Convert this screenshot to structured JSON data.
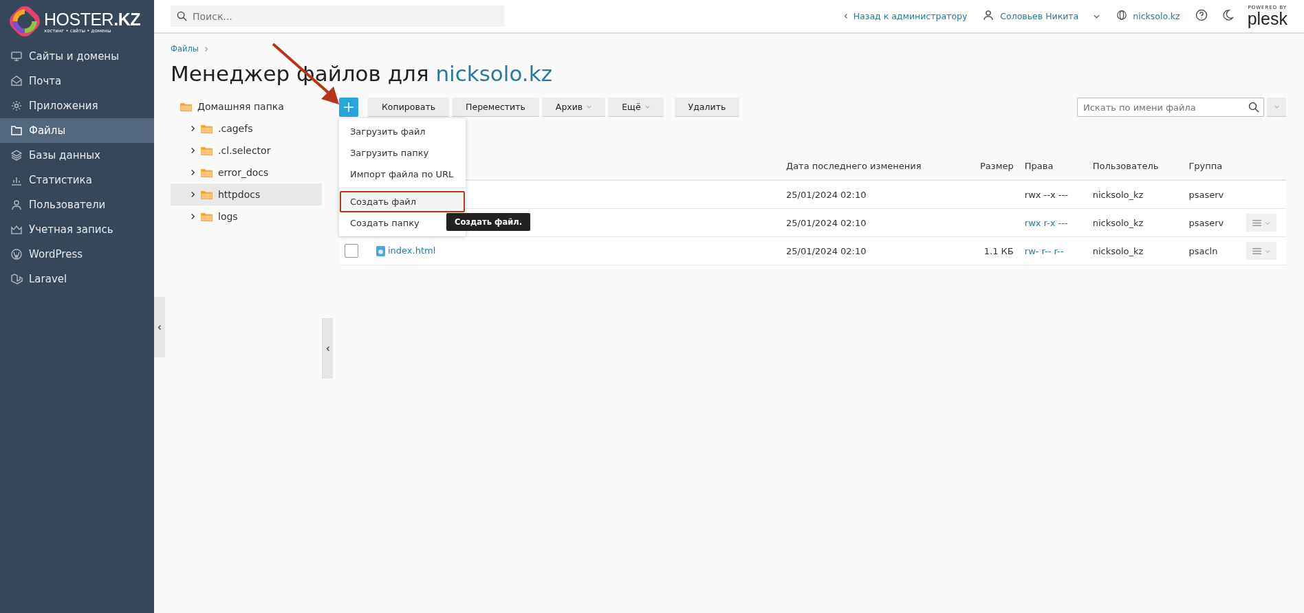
{
  "brand": {
    "name": "HOSTER**.KZ**",
    "tagline": "хостинг • сайты • домены"
  },
  "sidebar": {
    "items": [
      {
        "label": "Сайты и домены",
        "kind": "monitor",
        "selected": false
      },
      {
        "label": "Почта",
        "kind": "mail",
        "selected": false
      },
      {
        "label": "Приложения",
        "kind": "gear",
        "selected": false
      },
      {
        "label": "Файлы",
        "kind": "folder",
        "selected": true
      },
      {
        "label": "Базы данных",
        "kind": "layers",
        "selected": false
      },
      {
        "label": "Статистика",
        "kind": "chart",
        "selected": false
      },
      {
        "label": "Пользователи",
        "kind": "user",
        "selected": false
      },
      {
        "label": "Учетная запись",
        "kind": "crown",
        "selected": false
      },
      {
        "label": "WordPress",
        "kind": "wp",
        "selected": false
      },
      {
        "label": "Laravel",
        "kind": "laravel",
        "selected": false
      }
    ]
  },
  "topbar": {
    "search": {
      "placeholder": "Поиск..."
    },
    "back": "Назад к администратору",
    "user": "Соловьев Никита",
    "domain": "nicksolo.kz",
    "powered_by": "POWERED BY",
    "plesk": "plesk"
  },
  "breadcrumb": [
    "Файлы"
  ],
  "title": {
    "text": "Менеджер файлов для ",
    "domain": "nicksolo.kz"
  },
  "tree": {
    "root": "Домашняя папка",
    "children": [
      {
        "label": ".cagefs",
        "selected": false
      },
      {
        "label": ".cl.selector",
        "selected": false
      },
      {
        "label": "error_docs",
        "selected": false
      },
      {
        "label": "httpdocs",
        "selected": true
      },
      {
        "label": "logs",
        "selected": false
      }
    ]
  },
  "toolbar": {
    "buttons": [
      {
        "label": "Копировать",
        "dropdown": false
      },
      {
        "label": "Переместить",
        "dropdown": false
      },
      {
        "label": "Архив",
        "dropdown": true
      },
      {
        "label": "Ещё",
        "dropdown": true
      },
      {
        "label": "Удалить",
        "dropdown": false
      }
    ],
    "search": {
      "placeholder": "Искать по имени файла"
    }
  },
  "add_menu": {
    "items": [
      {
        "label": "Загрузить файл",
        "highlighted": false
      },
      {
        "label": "Загрузить папку",
        "highlighted": false
      },
      {
        "label": "Импорт файла по URL",
        "highlighted": false
      },
      {
        "label": "Создать файл",
        "highlighted": true
      },
      {
        "label": "Создать папку",
        "highlighted": false
      }
    ],
    "tooltip": "Создать файл."
  },
  "table": {
    "columns": [
      "Дата последнего изменения",
      "Размер",
      "Права",
      "Пользователь",
      "Группа"
    ],
    "rows": [
      {
        "date": "25/01/2024 02:10",
        "rights": "rwx --x ---",
        "rights_link": false,
        "user": "nicksolo_kz",
        "group": "psaserv",
        "actions": false
      },
      {
        "date": "25/01/2024 02:10",
        "rights": "rwx r-x ---",
        "rights_link": true,
        "user": "nicksolo_kz",
        "group": "psaserv",
        "actions": true
      },
      {
        "name": "index.html",
        "checked": false,
        "date": "25/01/2024 02:10",
        "size": "1.1 КБ",
        "rights": "rw- r-- r--",
        "rights_link": true,
        "user": "nicksolo_kz",
        "group": "psacln",
        "actions": true
      }
    ]
  }
}
